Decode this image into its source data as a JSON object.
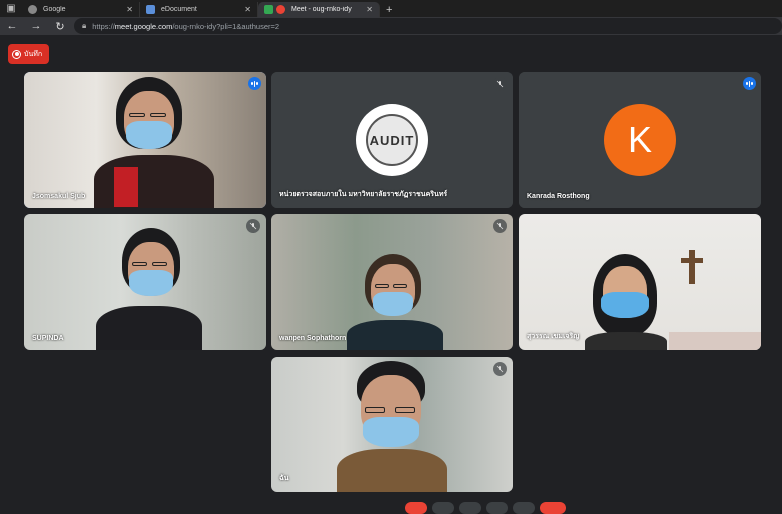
{
  "browser": {
    "tabs": [
      {
        "title": "Google",
        "active": false
      },
      {
        "title": "eDocument",
        "active": false
      },
      {
        "title": "Meet - oug-rnko-idy",
        "active": true
      }
    ],
    "url_prefix": "https://",
    "url_host": "meet.google.com",
    "url_path": "/oug-rnko-idy?pli=1&authuser=2"
  },
  "meet": {
    "record_label": "บันทึก",
    "participants": [
      {
        "name": "Jsomsakul Sjub",
        "state": "speaking"
      },
      {
        "name": "หน่วยตรวจสอบภายใน มหาวิทยาลัยราชภัฏราชนครินทร์",
        "state": "muted",
        "logo_text": "AUDIT"
      },
      {
        "name": "Kanrada Rosthong",
        "state": "speaking",
        "avatar_letter": "K"
      },
      {
        "name": "SUPINDA",
        "state": "muted"
      },
      {
        "name": "wanpen Sophathorn",
        "state": "muted"
      },
      {
        "name": "สุวรรณ เขมเจริญ",
        "state": "none"
      },
      {
        "name": "ฉัน",
        "state": "muted"
      }
    ]
  },
  "colors": {
    "accent": "#8ab4f8",
    "record": "#d93025",
    "avatar": "#f26c16",
    "speaking": "#1a73e8"
  }
}
